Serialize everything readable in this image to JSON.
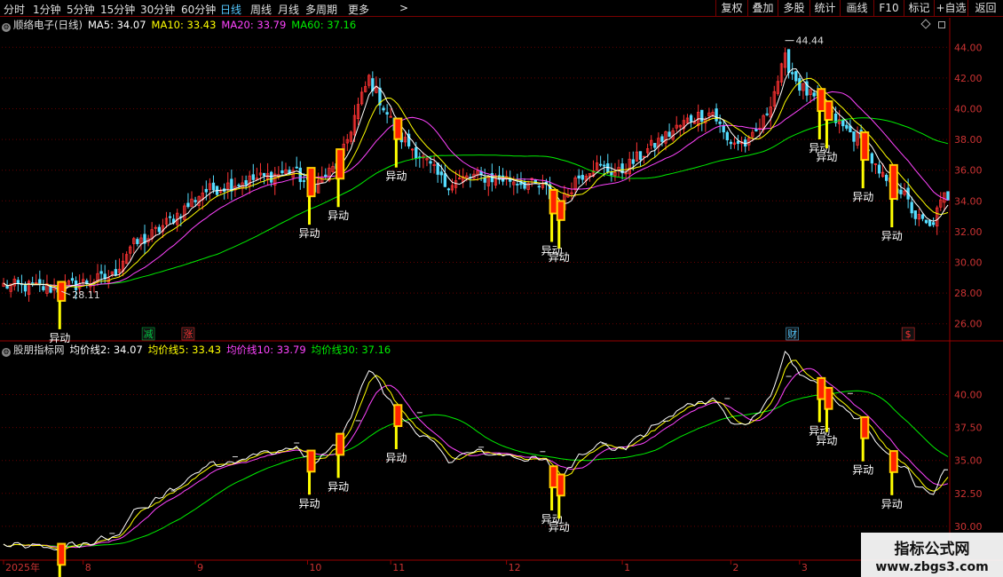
{
  "toolbar": {
    "periods": [
      {
        "label": "分时",
        "active": false
      },
      {
        "label": "1分钟",
        "active": false
      },
      {
        "label": "5分钟",
        "active": false
      },
      {
        "label": "15分钟",
        "active": false
      },
      {
        "label": "30分钟",
        "active": false
      },
      {
        "label": "60分钟",
        "active": false
      },
      {
        "label": "日线",
        "active": true
      },
      {
        "label": "周线",
        "active": false
      },
      {
        "label": "月线",
        "active": false
      },
      {
        "label": "多周期",
        "active": false
      },
      {
        "label": "更多",
        "active": false
      }
    ],
    "more_arrow": ">",
    "buttons": [
      "复权",
      "叠加",
      "多股",
      "统计",
      "画线",
      "F10",
      "标记",
      "+自选",
      "返回"
    ]
  },
  "main_legend": {
    "title": "顺络电子(日线)",
    "items": [
      {
        "label": "MA5: 34.07",
        "color": "#ffffff"
      },
      {
        "label": "MA10: 33.43",
        "color": "#ffff00"
      },
      {
        "label": "MA20: 33.79",
        "color": "#ff44ff"
      },
      {
        "label": "MA60: 37.16",
        "color": "#00ee00"
      }
    ]
  },
  "sub_legend": {
    "title": "股朋指标网",
    "items": [
      {
        "label": "均价线2: 34.07",
        "color": "#ffffff"
      },
      {
        "label": "均价线5: 33.43",
        "color": "#ffff00"
      },
      {
        "label": "均价线10: 33.79",
        "color": "#ff44ff"
      },
      {
        "label": "均价线30: 37.16",
        "color": "#00ee00"
      }
    ]
  },
  "colors": {
    "up": "#ff3333",
    "down": "#55ddff",
    "ma5": "#ffffff",
    "ma10": "#ffff00",
    "ma20": "#ff44ff",
    "ma60": "#00ee00",
    "signal_body": "#ff2200",
    "signal_edge": "#ffcc00",
    "signal_tail": "#ffff00",
    "axis": "#990000",
    "grid": "#660000",
    "axis_text": "#cc3333"
  },
  "chart_data": {
    "type": "candlestick",
    "x_month_labels": [
      "2025年",
      "8",
      "9",
      "10",
      "11",
      "12",
      "1",
      "2",
      "3"
    ],
    "main_axis": {
      "ylim": [
        25,
        45
      ],
      "ticks": [
        "26.00",
        "28.00",
        "30.00",
        "32.00",
        "34.00",
        "36.00",
        "38.00",
        "40.00",
        "42.00",
        "44.00"
      ]
    },
    "sub_axis": {
      "ylim": [
        27.5,
        43
      ],
      "ticks": [
        "30.00",
        "32.50",
        "35.00",
        "37.50",
        "40.00"
      ]
    },
    "high_label": "44.44",
    "low_label": "28.11",
    "signal_label": "异动",
    "signal_bars": [
      16,
      85,
      93,
      109,
      152,
      154,
      226,
      228,
      238,
      246
    ],
    "event_markers": [
      {
        "label": "减",
        "bar": 40,
        "color": "#00cc44"
      },
      {
        "label": "涨",
        "bar": 51,
        "color": "#ff3333"
      },
      {
        "label": "财",
        "bar": 218,
        "color": "#55c8ff"
      },
      {
        "label": "$",
        "bar": 250,
        "color": "#ff3333"
      }
    ],
    "keypoints": [
      [
        0,
        28.5
      ],
      [
        15,
        28.3
      ],
      [
        30,
        29.1
      ],
      [
        35,
        31.0
      ],
      [
        40,
        31.6
      ],
      [
        50,
        33.5
      ],
      [
        55,
        34.6
      ],
      [
        65,
        35.2
      ],
      [
        75,
        35.7
      ],
      [
        80,
        36.0
      ],
      [
        85,
        34.8
      ],
      [
        93,
        36.5
      ],
      [
        97,
        39.5
      ],
      [
        101,
        42.0
      ],
      [
        109,
        38.3
      ],
      [
        115,
        37.0
      ],
      [
        122,
        35.1
      ],
      [
        130,
        35.6
      ],
      [
        140,
        35.4
      ],
      [
        150,
        34.8
      ],
      [
        153,
        33.3
      ],
      [
        158,
        35.4
      ],
      [
        163,
        36.3
      ],
      [
        170,
        35.8
      ],
      [
        180,
        37.7
      ],
      [
        190,
        39.4
      ],
      [
        196,
        39.8
      ],
      [
        200,
        37.9
      ],
      [
        206,
        37.7
      ],
      [
        210,
        39.2
      ],
      [
        216,
        43.2
      ],
      [
        220,
        41.5
      ],
      [
        226,
        40.2
      ],
      [
        232,
        38.8
      ],
      [
        238,
        37.7
      ],
      [
        242,
        35.6
      ],
      [
        248,
        34.7
      ],
      [
        252,
        33.0
      ],
      [
        256,
        32.2
      ],
      [
        260,
        34.3
      ]
    ]
  },
  "watermark": {
    "title": "指标公式网",
    "url": "www.zbgs3.com"
  }
}
